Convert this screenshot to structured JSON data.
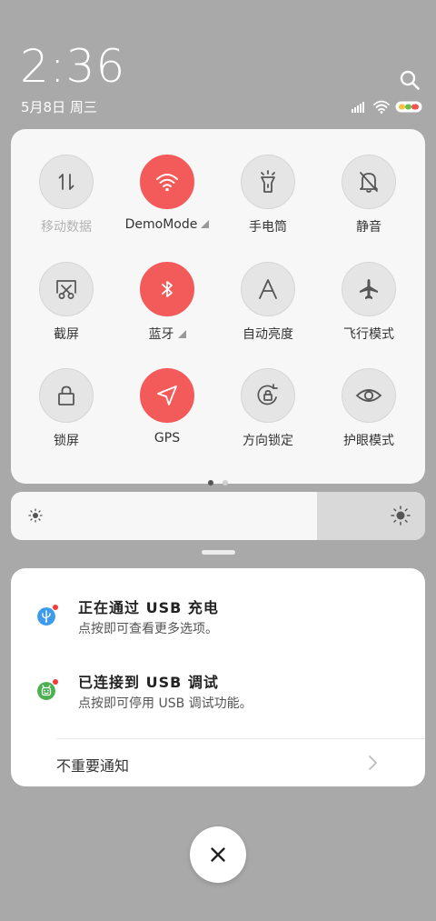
{
  "header": {
    "time": "2:36",
    "date": "5月8日 周三"
  },
  "quick_settings": {
    "tiles": [
      {
        "label": "移动数据",
        "icon": "mobile-data-icon",
        "active": false,
        "dim": true
      },
      {
        "label": "DemoMode",
        "icon": "wifi-icon",
        "active": true,
        "expandable": true
      },
      {
        "label": "手电筒",
        "icon": "flashlight-icon",
        "active": false
      },
      {
        "label": "静音",
        "icon": "bell-off-icon",
        "active": false
      },
      {
        "label": "截屏",
        "icon": "screenshot-icon",
        "active": false
      },
      {
        "label": "蓝牙",
        "icon": "bluetooth-icon",
        "active": true,
        "expandable": true
      },
      {
        "label": "自动亮度",
        "icon": "auto-brightness-icon",
        "active": false
      },
      {
        "label": "飞行模式",
        "icon": "airplane-icon",
        "active": false
      },
      {
        "label": "锁屏",
        "icon": "lock-icon",
        "active": false
      },
      {
        "label": "GPS",
        "icon": "location-icon",
        "active": true
      },
      {
        "label": "方向锁定",
        "icon": "rotation-lock-icon",
        "active": false
      },
      {
        "label": "护眼模式",
        "icon": "eye-icon",
        "active": false
      }
    ],
    "page_count": 2,
    "current_page": 1
  },
  "brightness": {
    "level": 0.74
  },
  "notifications": {
    "items": [
      {
        "title": "正在通过 USB 充电",
        "text": "点按即可查看更多选项。",
        "icon": "usb-icon",
        "color": "#3d9be9"
      },
      {
        "title": "已连接到 USB 调试",
        "text": "点按即可停用 USB 调试功能。",
        "icon": "android-debug-icon",
        "color": "#4caf50"
      }
    ],
    "unimportant_label": "不重要通知"
  },
  "colors": {
    "accent": "#f35a5a",
    "panel": "#f7f7f7",
    "backdrop": "#a9a9a9"
  }
}
